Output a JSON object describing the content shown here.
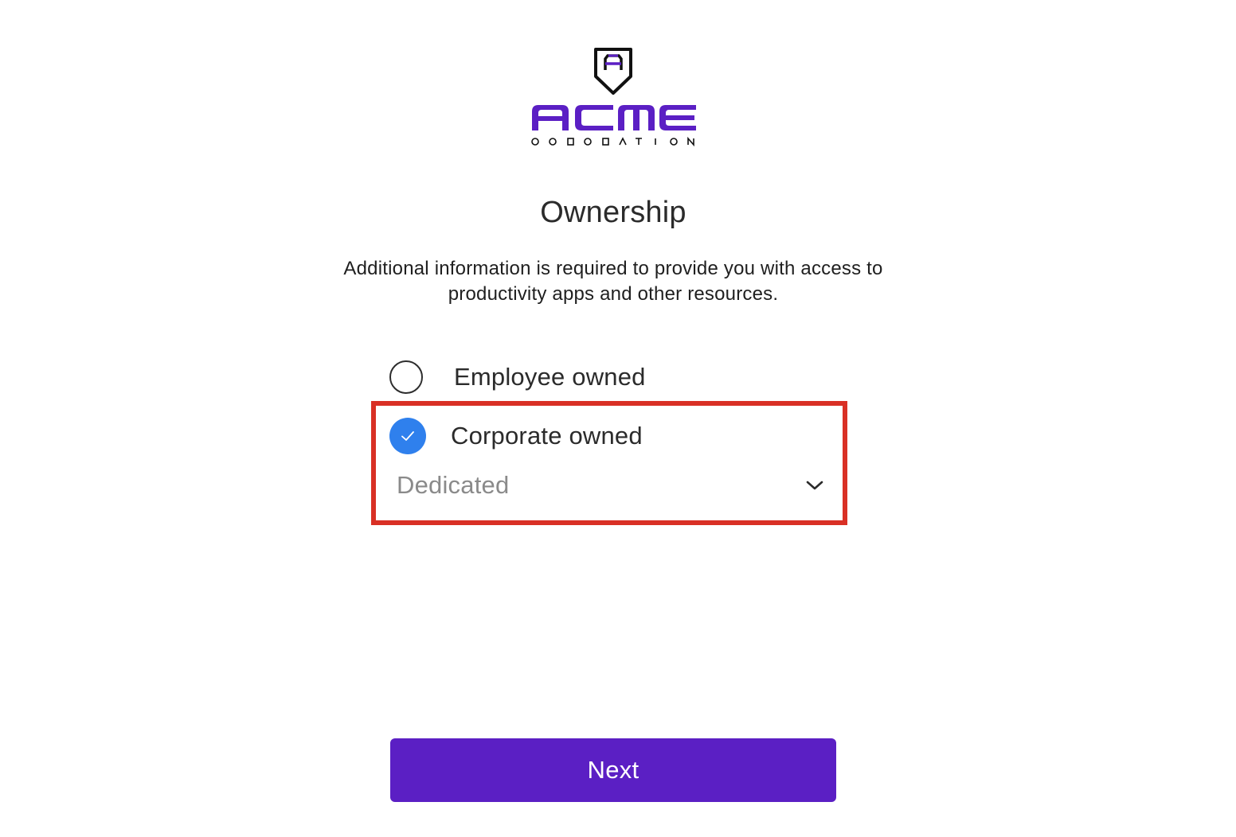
{
  "brand": {
    "logo_icon": "shield-a-logo-icon",
    "name": "ACME",
    "tagline": "CORPORATION",
    "color": "#5b1fc4"
  },
  "page": {
    "title": "Ownership",
    "description": "Additional information is required to provide you with access to productivity apps and other resources."
  },
  "ownership": {
    "options": [
      {
        "label": "Employee owned",
        "selected": false
      },
      {
        "label": "Corporate owned",
        "selected": true
      }
    ],
    "corporate_type": {
      "value": "Dedicated",
      "icon": "chevron-down-icon"
    }
  },
  "actions": {
    "next_label": "Next",
    "next_color": "#5b1fc4"
  },
  "colors": {
    "radio_checked": "#2f80ed",
    "highlight_border": "#d93025"
  }
}
